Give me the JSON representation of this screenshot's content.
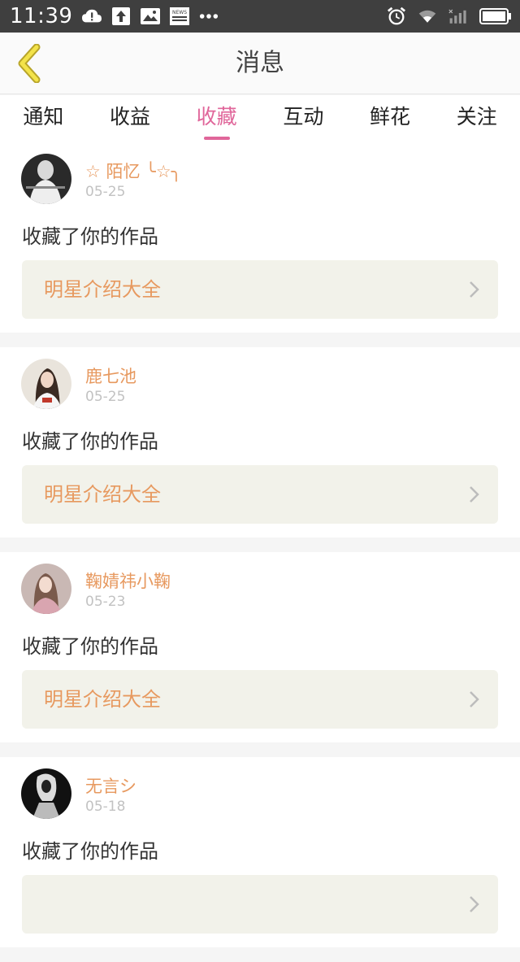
{
  "status_bar": {
    "time": "11:39",
    "news_label": "NEWS"
  },
  "header": {
    "title": "消息"
  },
  "tabs": [
    {
      "label": "通知"
    },
    {
      "label": "收益"
    },
    {
      "label": "收藏",
      "active": true
    },
    {
      "label": "互动"
    },
    {
      "label": "鲜花"
    },
    {
      "label": "关注"
    }
  ],
  "feed": [
    {
      "user": "☆ 陌忆 ╰☆╮",
      "date": "05-25",
      "action": "收藏了你的作品",
      "work": "明星介绍大全"
    },
    {
      "user": "鹿七池",
      "date": "05-25",
      "action": "收藏了你的作品",
      "work": "明星介绍大全"
    },
    {
      "user": "鞠婧祎小鞠",
      "date": "05-23",
      "action": "收藏了你的作品",
      "work": "明星介绍大全"
    },
    {
      "user": "无言シ",
      "date": "05-18",
      "action": "收藏了你的作品",
      "work": ""
    }
  ],
  "colors": {
    "accent": "#e0669a",
    "name_orange": "#e7995f",
    "status_bar_bg": "#3f3f3f",
    "back_arrow": "#f3e34a"
  }
}
